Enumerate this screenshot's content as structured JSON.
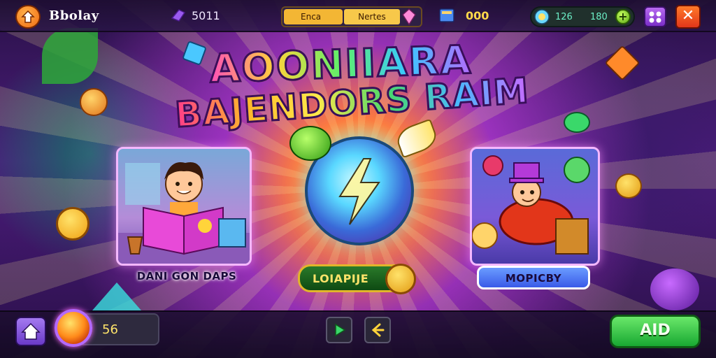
{
  "top_bar": {
    "title": "Bbolay",
    "gem_count": "5011",
    "event_tab": "Enca",
    "event_label": "Nertes",
    "book_count": "000",
    "currency_a": "126",
    "currency_b": "180",
    "plus_symbol": "+",
    "close_symbol": "✕"
  },
  "logo": {
    "line1": "AOONIIARA",
    "line2": "BAJENDORS RAIM"
  },
  "cards": {
    "left_label": "DANI GON DAPS",
    "right_label": "MOPICBY"
  },
  "center_button": {
    "label": "LOIAPIJE"
  },
  "bottom_bar": {
    "coin_count": "56",
    "go_label": "AID"
  },
  "colors": {
    "accent_orange": "#f06a12",
    "accent_green": "#18a832",
    "accent_purple": "#7a2ec8",
    "close_red": "#e2361a",
    "text_gold": "#ffe46a"
  },
  "icons": {
    "home": "home-arrow-icon",
    "gem": "purple-gem-icon",
    "book": "book-icon",
    "menu": "grid-menu-icon",
    "play": "play-icon",
    "back": "back-arrow-icon",
    "house": "house-icon"
  }
}
